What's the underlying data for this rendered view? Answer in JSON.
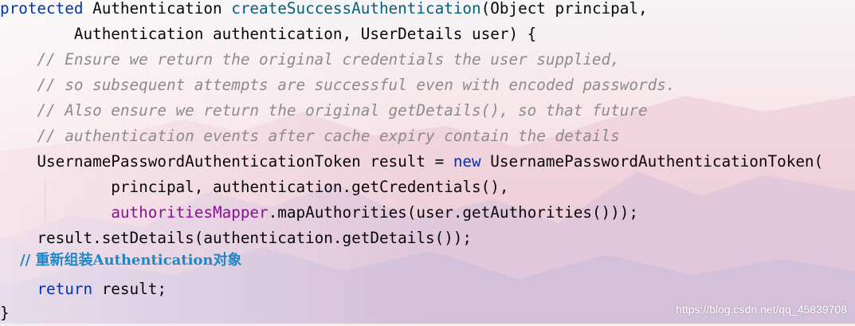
{
  "editor": {
    "lines": [
      {
        "tokens": [
          "protected",
          " Authentication ",
          "createSuccessAuthentication",
          "(Object principal,"
        ]
      },
      {
        "tokens": [
          "        Authentication authentication, UserDetails user) {"
        ]
      },
      {
        "tokens": [
          "    // Ensure we return the original credentials the user supplied,"
        ]
      },
      {
        "tokens": [
          "    // so subsequent attempts are successful even with encoded passwords."
        ]
      },
      {
        "tokens": [
          "    // Also ensure we return the original getDetails(), so that future"
        ]
      },
      {
        "tokens": [
          "    // authentication events after cache expiry contain the details"
        ]
      },
      {
        "tokens": [
          "    UsernamePasswordAuthenticationToken result = ",
          "new",
          " UsernamePasswordAuthenticationToken("
        ]
      },
      {
        "tokens": [
          "            principal, authentication.getCredentials(),"
        ]
      },
      {
        "tokens": [
          "            ",
          "authoritiesMapper",
          ".mapAuthorities(user.getAuthorities()));"
        ]
      },
      {
        "tokens": [
          "    result.setDetails(authentication.getDetails());"
        ]
      },
      {
        "tokens": [
          "    // 重新组装Authentication对象"
        ]
      },
      {
        "tokens": [
          "    ",
          "return",
          " result;"
        ]
      },
      {
        "tokens": [
          "}"
        ]
      }
    ]
  },
  "watermark": "https://blog.csdn.net/qq_45839708",
  "colors": {
    "keyword": "#0033b3",
    "method_name": "#00627a",
    "field": "#871094",
    "comment": "#8c8c8c",
    "custom_comment": "#1f86c7",
    "text": "#080808"
  }
}
